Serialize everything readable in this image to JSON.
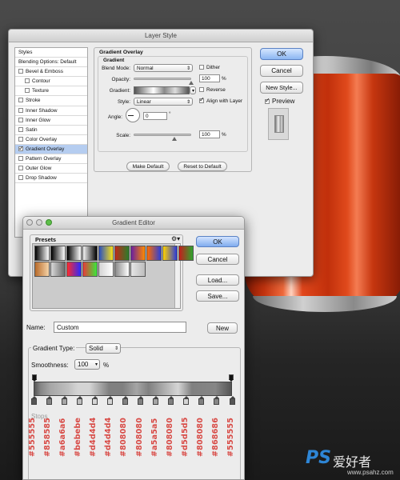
{
  "layer_style": {
    "title": "Layer Style",
    "styles_list": [
      {
        "label": "Styles",
        "checkbox": false,
        "checked": false,
        "indent": false,
        "selected": false
      },
      {
        "label": "Blending Options: Default",
        "checkbox": false,
        "checked": false,
        "indent": false,
        "selected": false
      },
      {
        "label": "Bevel & Emboss",
        "checkbox": true,
        "checked": false,
        "indent": false,
        "selected": false
      },
      {
        "label": "Contour",
        "checkbox": true,
        "checked": false,
        "indent": true,
        "selected": false
      },
      {
        "label": "Texture",
        "checkbox": true,
        "checked": false,
        "indent": true,
        "selected": false
      },
      {
        "label": "Stroke",
        "checkbox": true,
        "checked": false,
        "indent": false,
        "selected": false
      },
      {
        "label": "Inner Shadow",
        "checkbox": true,
        "checked": false,
        "indent": false,
        "selected": false
      },
      {
        "label": "Inner Glow",
        "checkbox": true,
        "checked": false,
        "indent": false,
        "selected": false
      },
      {
        "label": "Satin",
        "checkbox": true,
        "checked": false,
        "indent": false,
        "selected": false
      },
      {
        "label": "Color Overlay",
        "checkbox": true,
        "checked": false,
        "indent": false,
        "selected": false
      },
      {
        "label": "Gradient Overlay",
        "checkbox": true,
        "checked": true,
        "indent": false,
        "selected": true
      },
      {
        "label": "Pattern Overlay",
        "checkbox": true,
        "checked": false,
        "indent": false,
        "selected": false
      },
      {
        "label": "Outer Glow",
        "checkbox": true,
        "checked": false,
        "indent": false,
        "selected": false
      },
      {
        "label": "Drop Shadow",
        "checkbox": true,
        "checked": false,
        "indent": false,
        "selected": false
      }
    ],
    "group_title": "Gradient Overlay",
    "subgroup_title": "Gradient",
    "blend_mode_label": "Blend Mode:",
    "blend_mode_value": "Normal",
    "dither_label": "Dither",
    "dither_checked": false,
    "opacity_label": "Opacity:",
    "opacity_value": "100",
    "percent": "%",
    "gradient_label": "Gradient:",
    "reverse_label": "Reverse",
    "reverse_checked": false,
    "style_label": "Style:",
    "style_value": "Linear",
    "align_label": "Align with Layer",
    "align_checked": true,
    "angle_label": "Angle:",
    "angle_value": "0",
    "degree": "°",
    "scale_label": "Scale:",
    "scale_value": "100",
    "make_default": "Make Default",
    "reset_default": "Reset to Default",
    "ok": "OK",
    "cancel": "Cancel",
    "new_style": "New Style...",
    "preview_label": "Preview",
    "preview_checked": true
  },
  "gradient_editor": {
    "title": "Gradient Editor",
    "presets_label": "Presets",
    "gear_icon": "gear-icon",
    "ok": "OK",
    "cancel": "Cancel",
    "load": "Load...",
    "save": "Save...",
    "name_label": "Name:",
    "name_value": "Custom",
    "new_button": "New",
    "gradient_type_label": "Gradient Type:",
    "gradient_type_value": "Solid",
    "smoothness_label": "Smoothness:",
    "smoothness_value": "100",
    "percent": "%",
    "stops_label": "Stops",
    "preset_swatches": [
      [
        "#000000",
        "#ffffff"
      ],
      [
        "#000000",
        "#ffffff"
      ],
      [
        "#000000",
        "#ffffff"
      ],
      [
        "#f5f5f5",
        "#000000"
      ],
      [
        "#2a4fbf",
        "#f9e21a"
      ],
      [
        "#c02a1a",
        "#2a7d2a"
      ],
      [
        "#6a1fa0",
        "#ff8a00"
      ],
      [
        "#ff6a00",
        "#2b3fd8"
      ],
      [
        "#ffd200",
        "#2a3ad8"
      ],
      [
        "#c61c1c",
        "#2ea52e"
      ],
      [
        "#b86b2a",
        "#f5d3a8"
      ],
      [
        "#d8d8d8",
        "#6a6a6a"
      ],
      [
        "#ff2a2a",
        "#2a2aff"
      ],
      [
        "#e83a3a",
        "#3ae83a"
      ],
      [
        "#d4d4d4",
        "#ffffff"
      ],
      [
        "#8a8a8a",
        "#ffffff"
      ],
      [
        "#e6e6e6",
        "#bdbdbd"
      ]
    ],
    "color_stops": [
      {
        "hex": "#555555"
      },
      {
        "hex": "#858585"
      },
      {
        "hex": "#a6a6a6"
      },
      {
        "hex": "#bebebe"
      },
      {
        "hex": "#d4d4d4"
      },
      {
        "hex": "#d4d4d4"
      },
      {
        "hex": "#808080"
      },
      {
        "hex": "#808080"
      },
      {
        "hex": "#a5a5a5"
      },
      {
        "hex": "#808080"
      },
      {
        "hex": "#d5d5d5"
      },
      {
        "hex": "#808080"
      },
      {
        "hex": "#868686"
      },
      {
        "hex": "#555555"
      }
    ]
  },
  "watermark": {
    "logo": "PS",
    "cn": "爱好者",
    "url": "www.psahz.com"
  },
  "colors": {
    "hex_label": "#d84a45",
    "selection": "#b5cdf0",
    "can_red": "#c1300b",
    "watermark_blue": "#2e86d6"
  }
}
